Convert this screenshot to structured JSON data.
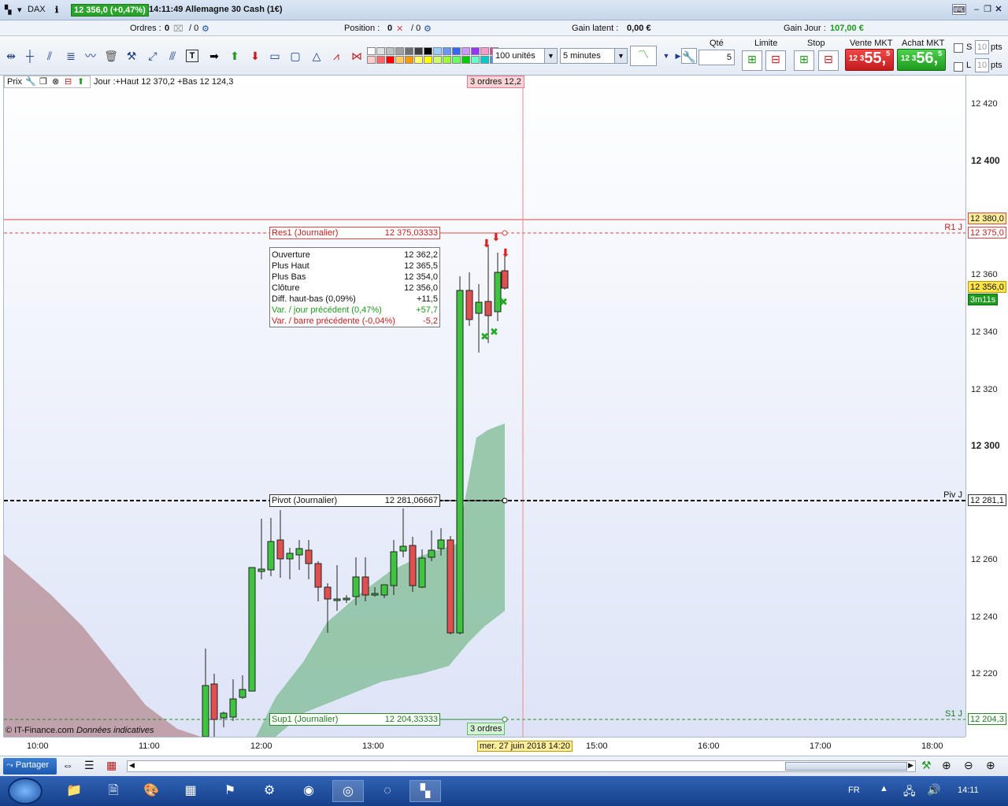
{
  "titlebar": {
    "instrument": "DAX",
    "price_change": "12 356,0 (+0,47%)",
    "time_name": "14:11:49 Allemagne 30 Cash (1€)"
  },
  "infobar": {
    "orders_label": "Ordres :",
    "orders_value": "0",
    "orders_total": "/ 0",
    "position_label": "Position :",
    "position_value": "0",
    "position_total": "/ 0",
    "gain_latent_label": "Gain latent :",
    "gain_latent_value": "0,00 €",
    "gain_jour_label": "Gain Jour :",
    "gain_jour_value": "107,00 €"
  },
  "toolbar": {
    "palette_colors": [
      "#ffffff",
      "#e0e0e0",
      "#c0c0c0",
      "#a0a0a0",
      "#707070",
      "#404040",
      "#000000",
      "#99ccff",
      "#6699ff",
      "#3366ff",
      "#cc99ff",
      "#9933ff",
      "#ff99cc",
      "#ff3399",
      "#ffcccc",
      "#ff6666",
      "#ff0000",
      "#ffcc66",
      "#ff9900",
      "#ffff66",
      "#ffff00",
      "#ccff66",
      "#99ff33",
      "#66ff66",
      "#00cc00",
      "#66ffcc",
      "#00cccc",
      "#3399ff"
    ],
    "units_value": "100 unités",
    "timeframe_value": "5 minutes",
    "qty_label": "Qté",
    "qty_value": "5",
    "limit_label": "Limite",
    "stop_label": "Stop",
    "sell_label": "Vente MKT",
    "buy_label": "Achat MKT",
    "sell_prefix": "12 3",
    "sell_big": "55,",
    "sell_sup": "5",
    "buy_prefix": "12 3",
    "buy_big": "56,",
    "buy_sup": "5",
    "s_label": "S",
    "s_value": "10",
    "l_label": "L",
    "l_value": "10",
    "pts_label": "pts"
  },
  "chart": {
    "prix_label": "Prix",
    "header_text": "Jour :+Haut 12 370,2 +Bas 12 124,3",
    "orders_top": "3 ordres ",
    "orders_top_suffix": "12,2",
    "orders_bottom": "3 ordres ",
    "copyright": "© IT-Finance.com",
    "disclaimer": "Données indicatives",
    "res1_label": "Res1 (Journalier)",
    "res1_value": "12 375,03333",
    "pivot_label": "Pivot (Journalier)",
    "pivot_value": "12 281,06667",
    "sup1_label": "Sup1 (Journalier)",
    "sup1_value": "12 204,33333",
    "r1_tag": "R1 J",
    "piv_tag": "Piv J",
    "s1_tag": "S1 J",
    "info": [
      {
        "k": "Ouverture",
        "v": "12 362,2",
        "color": "#111111"
      },
      {
        "k": "Plus Haut",
        "v": "12 365,5",
        "color": "#111111"
      },
      {
        "k": "Plus Bas",
        "v": "12 354,0",
        "color": "#111111"
      },
      {
        "k": "Clôture",
        "v": "12 356,0",
        "color": "#111111"
      },
      {
        "k": "Diff. haut-bas (0,09%)",
        "v": "+11,5",
        "color": "#111111"
      },
      {
        "k": "Var. / jour précédent (0,47%)",
        "v": "+57,7",
        "color": "#1e9a1e"
      },
      {
        "k": "Var. / barre précédente (-0,04%)",
        "v": "-5,2",
        "color": "#c41c1c"
      }
    ]
  },
  "right_axis": {
    "labels": [
      {
        "text": "12 420",
        "bold": false
      },
      {
        "text": "12 400",
        "bold": true
      },
      {
        "text": "12 360",
        "bold": false
      },
      {
        "text": "12 340",
        "bold": false
      },
      {
        "text": "12 320",
        "bold": false
      },
      {
        "text": "12 300",
        "bold": true
      },
      {
        "text": "12 260",
        "bold": false
      },
      {
        "text": "12 240",
        "bold": false
      },
      {
        "text": "12 220",
        "bold": false
      }
    ],
    "tag_380": "12 380,0",
    "tag_375": "12 375,0",
    "tag_356": "12 356,0",
    "tag_timer": "3m11s",
    "tag_281": "12 281,1",
    "tag_204": "12 204,3"
  },
  "time_axis": {
    "labels": [
      "10:00",
      "11:00",
      "12:00",
      "13:00",
      "15:00",
      "16:00",
      "17:00",
      "18:00"
    ],
    "cursor_label": "mer. 27 juin 2018 14:20"
  },
  "bottom_bar": {
    "share_label": "Partager"
  },
  "taskbar": {
    "lang": "FR",
    "clock": "14:11"
  }
}
